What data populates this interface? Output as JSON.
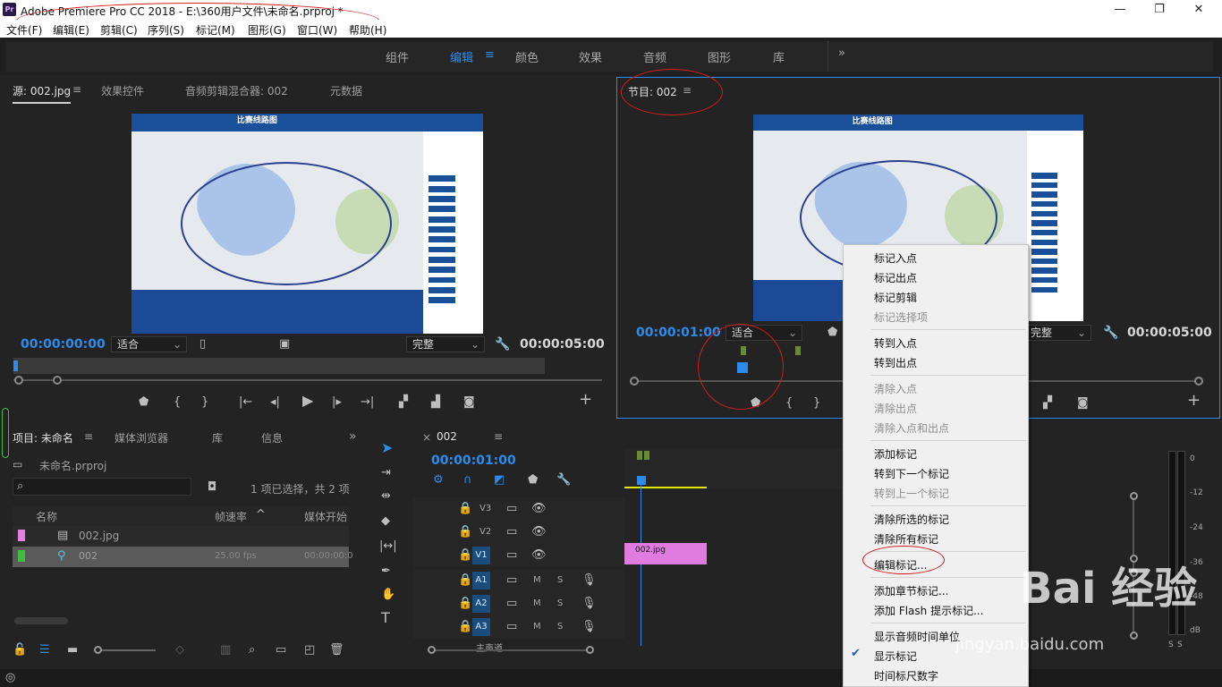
{
  "titlebar": {
    "app_icon": "Pr",
    "title": "Adobe Premiere Pro CC 2018 - E:\\360用户文件\\未命名.prproj *",
    "minimize": "—",
    "maximize": "❐",
    "close": "✕"
  },
  "menubar": {
    "items": [
      "文件(F)",
      "编辑(E)",
      "剪辑(C)",
      "序列(S)",
      "标记(M)",
      "图形(G)",
      "窗口(W)",
      "帮助(H)"
    ]
  },
  "workspace": {
    "tabs": [
      "组件",
      "编辑",
      "颜色",
      "效果",
      "音频",
      "图形",
      "库"
    ],
    "active": "编辑",
    "menu_icon": "≡",
    "more": "»"
  },
  "source": {
    "tabs": [
      "源: 002.jpg",
      "效果控件",
      "音频剪辑混合器: 002",
      "元数据"
    ],
    "menu_icon": "≡",
    "timecode_in": "00:00:00:00",
    "fit": "适合",
    "quality": "完整",
    "timecode_out": "00:00:05:00",
    "map_title": "比赛线路图"
  },
  "program": {
    "tab": "节目: 002",
    "menu_icon": "≡",
    "timecode_in": "00:00:01:00",
    "fit": "适合",
    "quality": "完整",
    "timecode_out": "00:00:05:00",
    "map_title": "比赛线路图"
  },
  "project": {
    "tabs": [
      "项目: 未命名",
      "媒体浏览器",
      "库",
      "信息"
    ],
    "menu_icon": "≡",
    "more": "»",
    "file": "未命名.prproj",
    "status": "1 项已选择，共 2 项",
    "cols": [
      "名称",
      "帧速率",
      "媒体开始"
    ],
    "rows": [
      {
        "name": "002.jpg",
        "fps": "",
        "start": ""
      },
      {
        "name": "002",
        "fps": "25.00 fps",
        "start": "00:00:00:0"
      }
    ],
    "row_colors": [
      "#e27fe0",
      "#3fbf3f"
    ]
  },
  "timeline": {
    "tab": "002",
    "close": "×",
    "menu_icon": "≡",
    "timecode": "00:00:01:00",
    "tracks_v": [
      "V3",
      "V2",
      "V1"
    ],
    "tracks_a": [
      "A1",
      "A2",
      "A3"
    ],
    "track_m": "M",
    "track_s": "S",
    "master": "主声道",
    "clip": "002.jpg"
  },
  "meter": {
    "labels": [
      "0",
      "-12",
      "-24",
      "-36",
      "-48",
      "dB"
    ],
    "solo": "S",
    "solo2": "S"
  },
  "context_menu": {
    "items": [
      {
        "label": "标记入点",
        "enabled": true
      },
      {
        "label": "标记出点",
        "enabled": true
      },
      {
        "label": "标记剪辑",
        "enabled": true
      },
      {
        "label": "标记选择项",
        "enabled": false
      },
      {
        "label": "转到入点",
        "enabled": true
      },
      {
        "label": "转到出点",
        "enabled": true
      },
      {
        "label": "清除入点",
        "enabled": false
      },
      {
        "label": "清除出点",
        "enabled": false
      },
      {
        "label": "清除入点和出点",
        "enabled": false
      },
      {
        "label": "添加标记",
        "enabled": true
      },
      {
        "label": "转到下一个标记",
        "enabled": true
      },
      {
        "label": "转到上一个标记",
        "enabled": false
      },
      {
        "label": "清除所选的标记",
        "enabled": true
      },
      {
        "label": "清除所有标记",
        "enabled": true
      },
      {
        "label": "编辑标记...",
        "enabled": true
      },
      {
        "label": "添加章节标记...",
        "enabled": true
      },
      {
        "label": "添加 Flash 提示标记...",
        "enabled": true
      },
      {
        "label": "显示音频时间单位",
        "enabled": true
      },
      {
        "label": "显示标记",
        "enabled": true,
        "checked": true
      },
      {
        "label": "时间标尺数字",
        "enabled": true
      }
    ],
    "check": "✔"
  },
  "watermark": {
    "brand": "Bai 经验",
    "url": "jingyan.baidu.com"
  }
}
